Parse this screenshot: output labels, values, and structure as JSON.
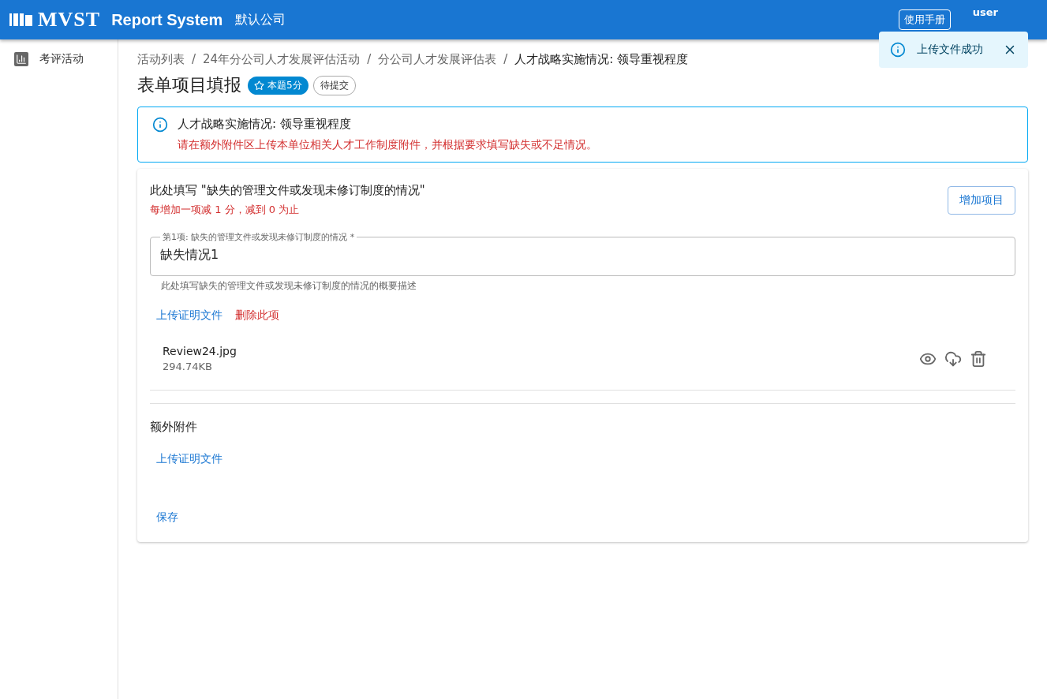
{
  "header": {
    "logo": "MVST",
    "title": "Report System",
    "company": "默认公司",
    "manual_button": "使用手册",
    "user": "user"
  },
  "toast": {
    "message": "上传文件成功"
  },
  "sidebar": {
    "items": [
      {
        "label": "考评活动",
        "selected": false
      }
    ]
  },
  "breadcrumb": [
    {
      "label": "活动列表",
      "current": false
    },
    {
      "label": "24年分公司人才发展评估活动",
      "current": false
    },
    {
      "label": "分公司人才发展评估表",
      "current": false
    },
    {
      "label": "人才战略实施情况: 领导重视程度",
      "current": true
    }
  ],
  "breadcrumb_separator": "/",
  "page": {
    "title": "表单项目填报",
    "score_badge": "本题5分",
    "status_badge": "待提交"
  },
  "info": {
    "title": "人才战略实施情况: 领导重视程度",
    "description": "请在额外附件区上传本单位相关人才工作制度附件，并根据要求填写缺失或不足情况。"
  },
  "section": {
    "title": "此处填写 \"缺失的管理文件或发现未修订制度的情况\"",
    "rule": "每增加一项减 1 分，减到 0 为止",
    "add_button": "增加项目",
    "items": [
      {
        "label": "第1项: 缺失的管理文件或发现未修订制度的情况 *",
        "value": "缺失情况1",
        "helper": "此处填写缺失的管理文件或发现未修订制度的情况的概要描述",
        "upload_link": "上传证明文件",
        "delete_link": "删除此项",
        "files": [
          {
            "name": "Review24.jpg",
            "size": "294.74KB"
          }
        ]
      }
    ]
  },
  "extra": {
    "title": "额外附件",
    "upload_link": "上传证明文件"
  },
  "save_button": "保存"
}
